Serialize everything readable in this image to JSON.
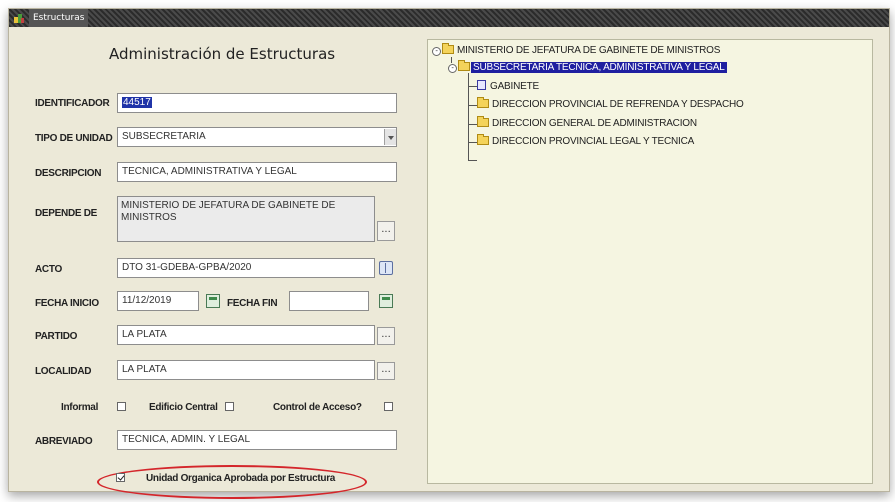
{
  "window": {
    "title": "Estructuras"
  },
  "form": {
    "heading": "Administración de Estructuras",
    "identificador": {
      "label": "IDENTIFICADOR",
      "value": "44517"
    },
    "tipo_unidad": {
      "label": "TIPO DE UNIDAD",
      "value": "SUBSECRETARIA"
    },
    "descripcion": {
      "label": "DESCRIPCION",
      "value": "TECNICA, ADMINISTRATIVA Y LEGAL"
    },
    "depende_de": {
      "label": "DEPENDE DE",
      "value": "MINISTERIO DE JEFATURA DE GABINETE DE MINISTROS",
      "button": "..."
    },
    "acto": {
      "label": "ACTO",
      "value": "DTO 31-GDEBA-GPBA/2020"
    },
    "fecha_inicio": {
      "label": "FECHA INICIO",
      "value": "11/12/2019"
    },
    "fecha_fin": {
      "label": "FECHA FIN",
      "value": ""
    },
    "partido": {
      "label": "PARTIDO",
      "value": "LA PLATA",
      "button": "..."
    },
    "localidad": {
      "label": "LOCALIDAD",
      "value": "LA PLATA",
      "button": "..."
    },
    "informal": {
      "label": "Informal",
      "checked": false
    },
    "edificio_central": {
      "label": "Edificio Central",
      "checked": false
    },
    "control_acceso": {
      "label": "Control de Acceso?",
      "checked": false
    },
    "abreviado": {
      "label": "ABREVIADO",
      "value": "TECNICA, ADMIN. Y LEGAL"
    },
    "unidad_aprobada": {
      "label": "Unidad Organica Aprobada por Estructura",
      "checked": true
    }
  },
  "tree": {
    "root": "MINISTERIO DE JEFATURA DE GABINETE DE MINISTROS",
    "selected": "SUBSECRETARIA TECNICA, ADMINISTRATIVA Y LEGAL",
    "children": [
      {
        "label": "GABINETE",
        "icon": "document-icon"
      },
      {
        "label": "DIRECCION PROVINCIAL DE REFRENDA Y DESPACHO",
        "icon": "folder-icon"
      },
      {
        "label": "DIRECCION GENERAL DE ADMINISTRACION",
        "icon": "folder-icon"
      },
      {
        "label": "DIRECCION PROVINCIAL LEGAL Y TECNICA",
        "icon": "folder-icon"
      }
    ]
  },
  "colors": {
    "highlight_oval": "#d4262b",
    "tree_selection": "#1f1fa0",
    "tree_background": "#f5f5e1"
  }
}
